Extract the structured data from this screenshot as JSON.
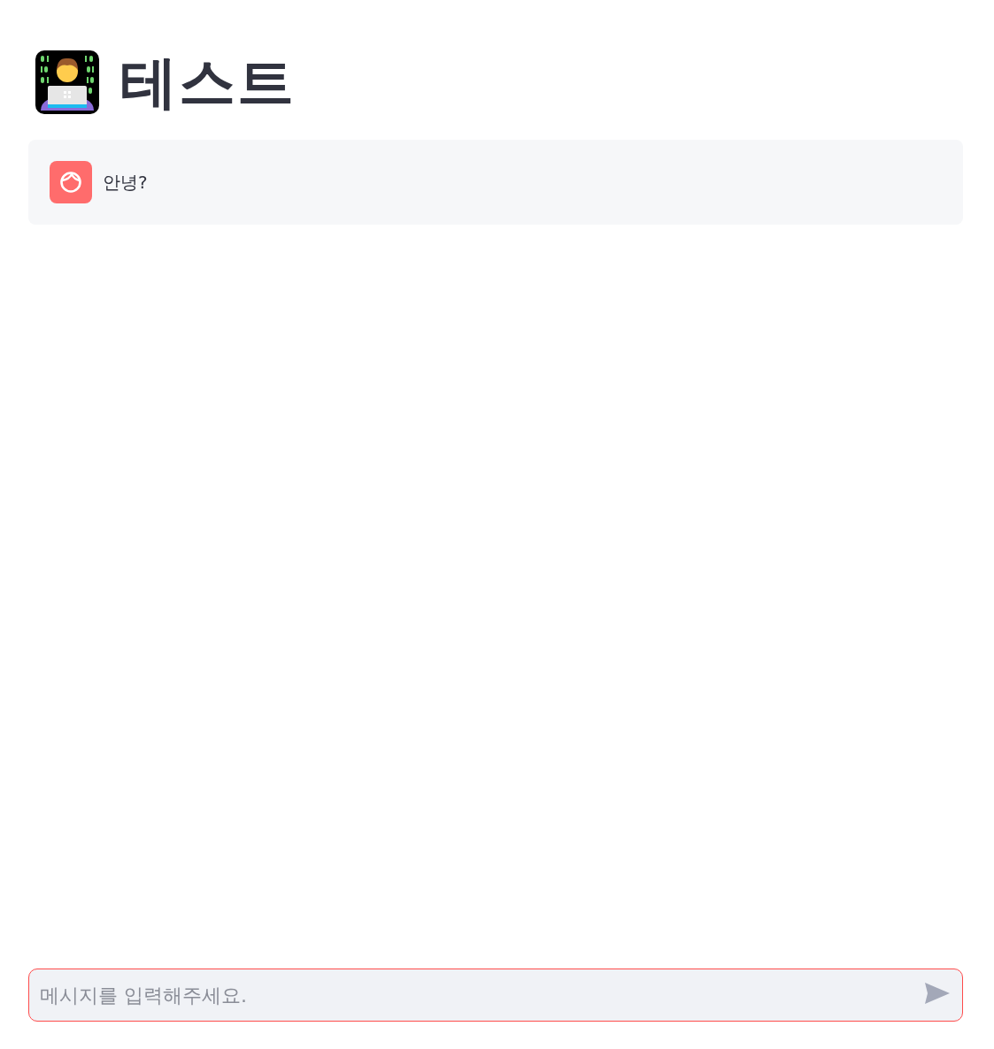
{
  "title": "테스트",
  "messages": [
    {
      "kind": "user",
      "text": "안녕?"
    }
  ],
  "chat_input": {
    "placeholder": "메시지를 입력해주세요.",
    "focused": true
  }
}
